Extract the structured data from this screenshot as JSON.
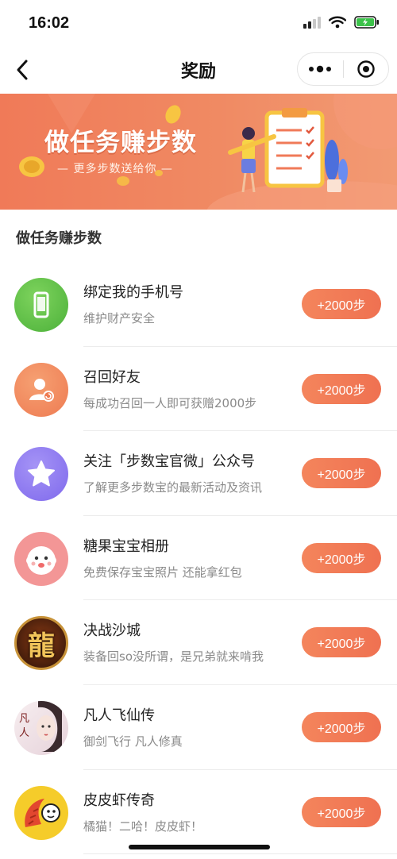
{
  "status_bar": {
    "time": "16:02"
  },
  "nav": {
    "title": "奖励"
  },
  "banner": {
    "title": "做任务赚步数",
    "subtitle": "— 更多步数送给你 —"
  },
  "section": {
    "title": "做任务赚步数"
  },
  "colors": {
    "accent": "#ef7151",
    "banner": "#f07a58",
    "phone_icon": "#5cc045",
    "friend_icon": "#f08a5c",
    "star_icon": "#8d78f0",
    "baby_icon": "#f28b8b"
  },
  "tasks": [
    {
      "icon": "phone-icon",
      "name": "绑定我的手机号",
      "desc": "维护财产安全",
      "reward": "+2000步"
    },
    {
      "icon": "recall-friend-icon",
      "name": "召回好友",
      "desc": "每成功召回一人即可获赠2000步",
      "reward": "+2000步"
    },
    {
      "icon": "star-icon",
      "name": "关注「步数宝官微」公众号",
      "desc": "了解更多步数宝的最新活动及资讯",
      "reward": "+2000步"
    },
    {
      "icon": "baby-face-icon",
      "name": "糖果宝宝相册",
      "desc": "免费保存宝宝照片 还能拿红包",
      "reward": "+2000步"
    },
    {
      "icon": "dragon-game-icon",
      "name": "决战沙城",
      "desc": "装备回so没所谓，是兄弟就来啃我",
      "reward": "+2000步"
    },
    {
      "icon": "fairy-game-icon",
      "name": "凡人飞仙传",
      "desc": "御剑飞行 凡人修真",
      "reward": "+2000步"
    },
    {
      "icon": "shrimp-game-icon",
      "name": "皮皮虾传奇",
      "desc": "橘猫！二哈！皮皮虾！",
      "reward": "+2000步"
    }
  ]
}
